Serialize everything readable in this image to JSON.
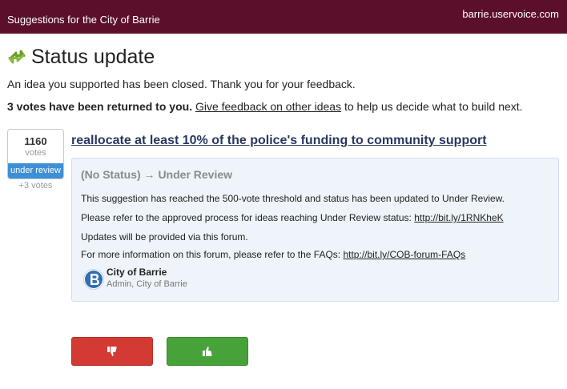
{
  "header": {
    "title": "Suggestions for the City of Barrie",
    "domain": "barrie.uservoice.com"
  },
  "status": {
    "heading": "Status update",
    "message": "An idea you supported has been closed. Thank you for your feedback.",
    "votes_returned": "3 votes have been returned to you.",
    "feedback_link": "Give feedback on other ideas",
    "feedback_suffix": " to help us decide what to build next."
  },
  "idea": {
    "vote_count": "1160",
    "vote_label": "votes",
    "badge": "under review",
    "plus_votes": "+3 votes",
    "title": "reallocate at least 10% of the police's funding to community support"
  },
  "update": {
    "status_change": "(No Status) → Under Review",
    "p1": "This suggestion has reached the 500-vote threshold and status has been updated to Under Review.",
    "p2_text": "Please refer to the approved process for ideas reaching Under Review status: ",
    "p2_link": "http://bit.ly/1RNKheK",
    "p3": "Updates will be provided via this forum.",
    "p4_text": "For more information on this forum, please refer to the FAQs: ",
    "p4_link": "http://bit.ly/COB-forum-FAQs",
    "author_name": "City of Barrie",
    "author_role": "Admin, City of Barrie"
  },
  "colors": {
    "header": "#5b0f2b",
    "badge": "#3d8fd6",
    "thumbs_down": "#d33a33",
    "thumbs_up": "#48a23a"
  },
  "icons": {
    "status": "status-arrows-icon",
    "avatar": "city-logo-icon",
    "down": "thumbs-down-icon",
    "up": "thumbs-up-icon"
  }
}
